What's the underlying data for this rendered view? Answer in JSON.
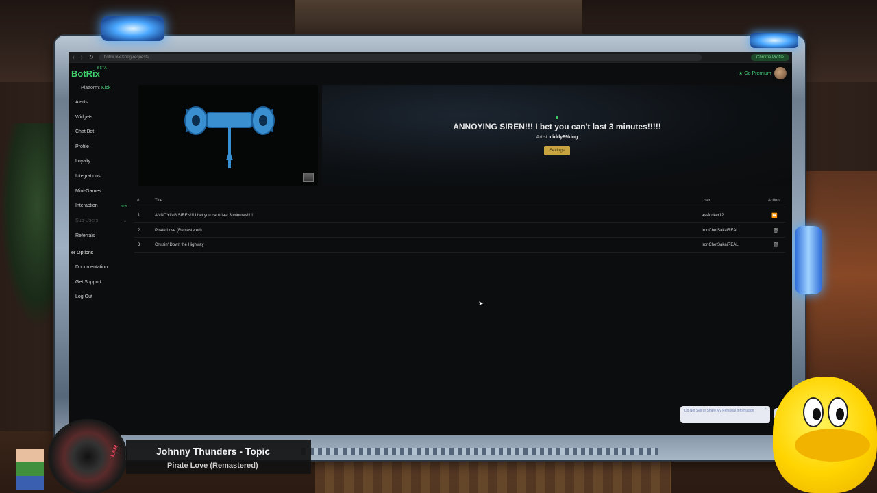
{
  "browser": {
    "url": "botrix.live/song-requests",
    "account_chip": "Chrome Profile"
  },
  "header": {
    "logo": "BotRix",
    "beta": "BETA",
    "premium": "Go Premium"
  },
  "sidebar": {
    "platform_label": "Platform:",
    "platform_value": "Kick",
    "items": [
      {
        "label": "Alerts"
      },
      {
        "label": "Widgets"
      },
      {
        "label": "Chat Bot"
      },
      {
        "label": "Profile"
      },
      {
        "label": "Loyalty"
      },
      {
        "label": "Integrations"
      },
      {
        "label": "Mini-Games"
      },
      {
        "label": "Interaction",
        "badge": "NEW"
      },
      {
        "label": "Sub-Users"
      },
      {
        "label": "Referrals"
      }
    ],
    "section_title": "er Options",
    "options": [
      {
        "label": "Documentation"
      },
      {
        "label": "Get Support"
      },
      {
        "label": "Log Out"
      }
    ]
  },
  "now_playing": {
    "title": "ANNOYING SIREN!!! I bet you can't last 3 minutes!!!!!",
    "artist_label": "Artist:",
    "artist": "diddy89king",
    "settings_button": "Settings"
  },
  "queue": {
    "columns": [
      "#",
      "Title",
      "User",
      "Action"
    ],
    "rows": [
      {
        "num": "1",
        "title": "ANNOYING SIREN!!! I bet you can't last 3 minutes!!!!!",
        "user": "assfucker12",
        "action": "skip-icon"
      },
      {
        "num": "2",
        "title": "Pirate Love (Remastered)",
        "user": "IronChefSakaiREAL",
        "action": "trash-icon"
      },
      {
        "num": "3",
        "title": "Cruisin' Down the Highway",
        "user": "IronChefSakaiREAL",
        "action": "trash-icon"
      }
    ]
  },
  "cookie": {
    "text": "Do Not Sell or Share My Personal Information",
    "close": "×"
  },
  "overlay": {
    "artist": "Johnny Thunders - Topic",
    "track": "Pirate Love (Remastered)",
    "disc_label": "LAM"
  },
  "colors": {
    "accent_green": "#3fd06b",
    "settings_gold": "#c8a440",
    "frame_blue": "#4aa8ff"
  }
}
